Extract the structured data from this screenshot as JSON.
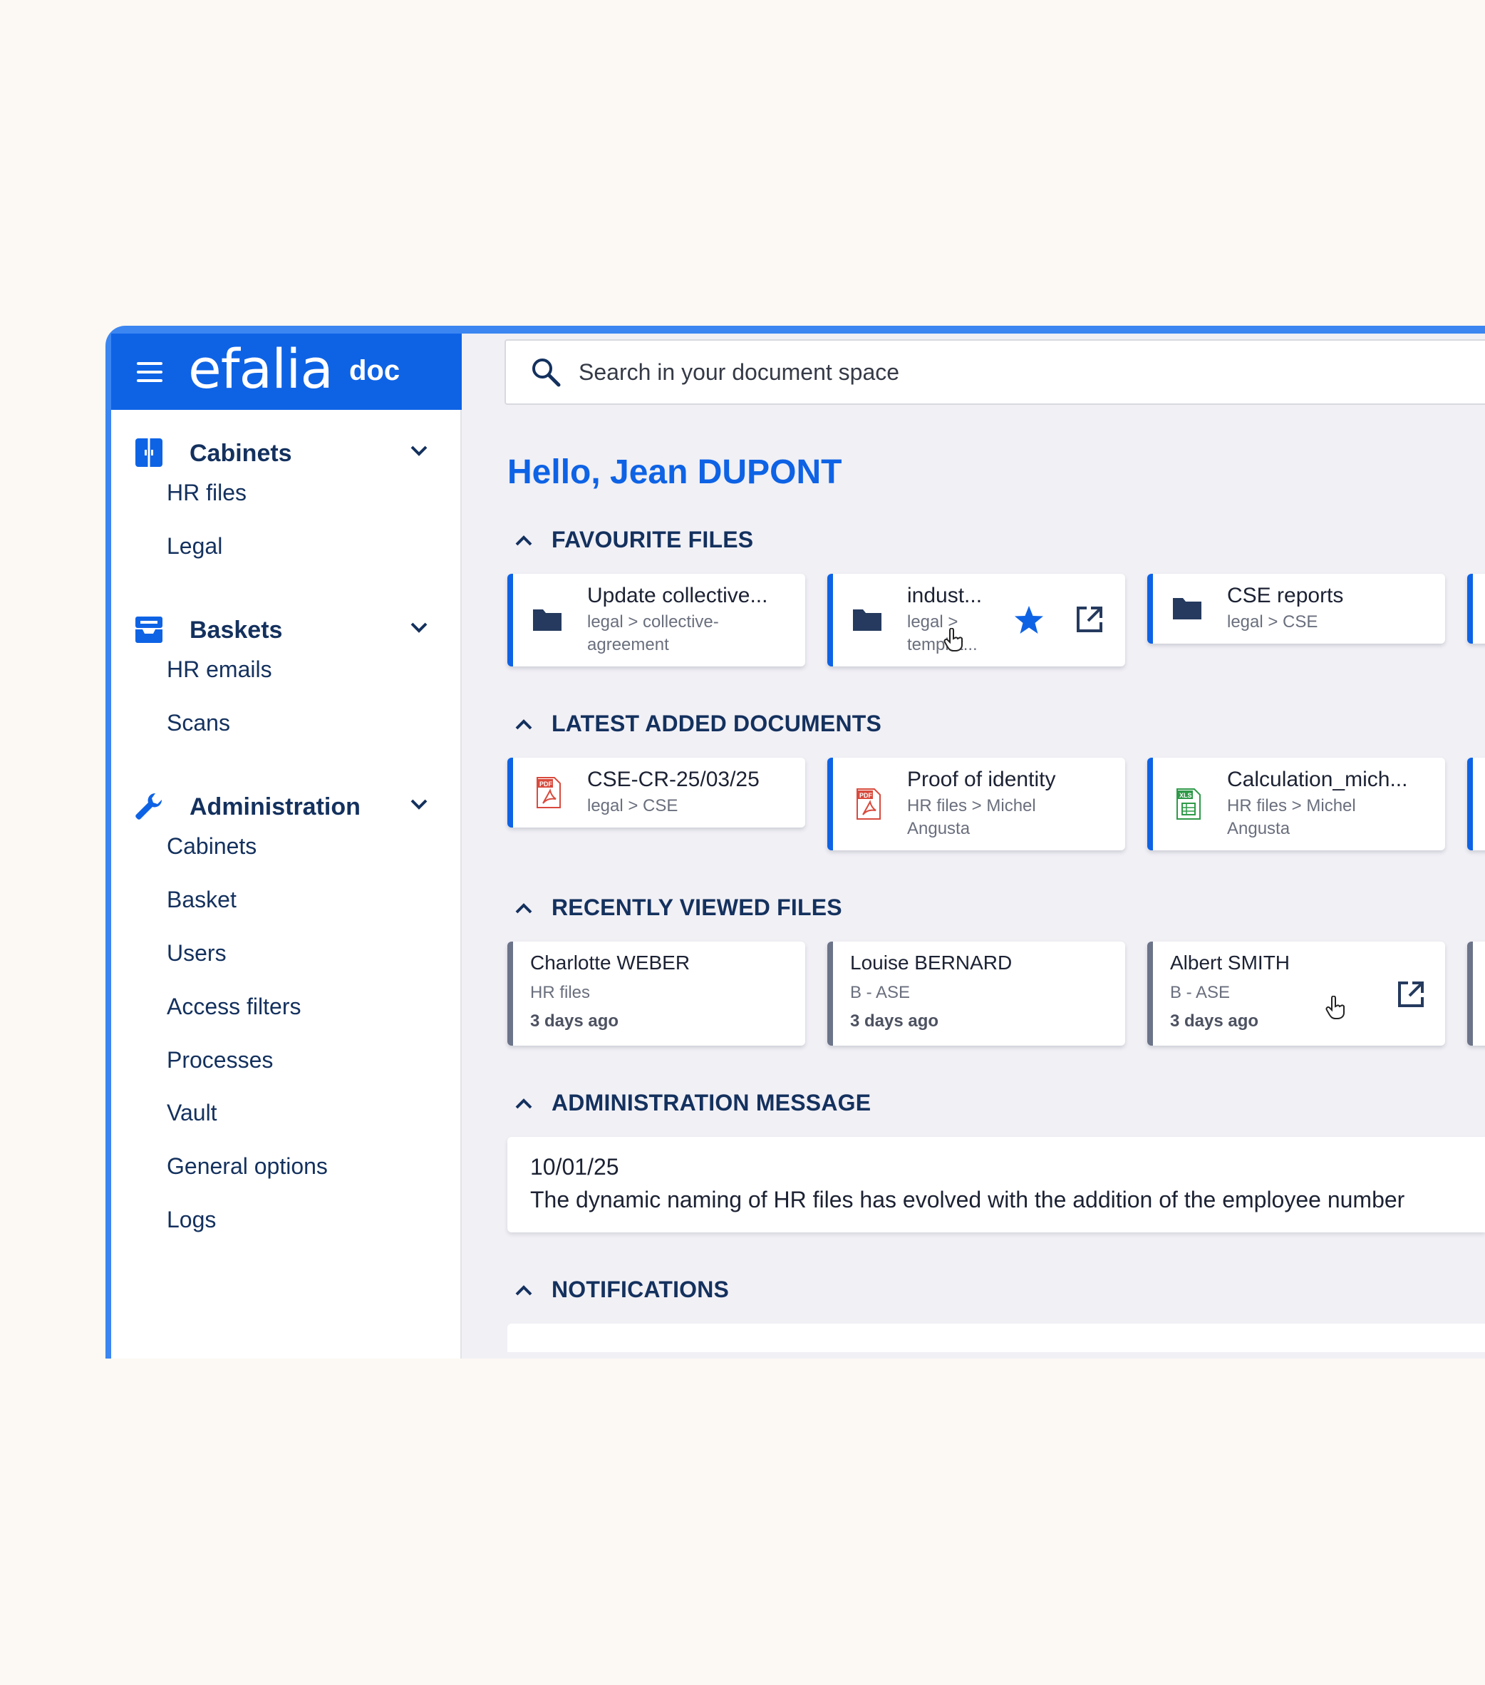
{
  "app": {
    "logo_word": "efalia",
    "logo_suffix": "doc",
    "search_placeholder": "Search in your document space"
  },
  "sidebar": {
    "sections": [
      {
        "title": "Cabinets",
        "icon": "cabinet-icon",
        "items": [
          "HR files",
          "Legal"
        ]
      },
      {
        "title": "Baskets",
        "icon": "inbox-tray-icon",
        "items": [
          "HR emails",
          "Scans"
        ]
      },
      {
        "title": "Administration",
        "icon": "wrench-icon",
        "items": [
          "Cabinets",
          "Basket",
          "Users",
          "Access filters",
          "Processes",
          "Vault",
          "General options",
          "Logs"
        ]
      }
    ]
  },
  "main": {
    "greeting": "Hello, Jean DUPONT",
    "favourites": {
      "title": "FAVOURITE FILES",
      "cards": [
        {
          "title": "Update collective...",
          "path_1": "legal > collective-",
          "path_2": "agreement",
          "icon": "folder-icon"
        },
        {
          "title": "indust...",
          "path_1": "legal >",
          "path_2": "templat...",
          "icon": "folder-icon",
          "starred": true
        },
        {
          "title": "CSE reports",
          "path_1": "legal > CSE",
          "path_2": "",
          "icon": "folder-icon"
        }
      ]
    },
    "latest": {
      "title": "LATEST ADDED DOCUMENTS",
      "cards": [
        {
          "title": "CSE-CR-25/03/25",
          "path_1": "legal > CSE",
          "path_2": "",
          "icon": "pdf-file-icon",
          "badge": "PDF"
        },
        {
          "title": "Proof of identity",
          "path_1": "HR files > Michel",
          "path_2": "Angusta",
          "icon": "pdf-file-icon",
          "badge": "PDF"
        },
        {
          "title": "Calculation_mich...",
          "path_1": "HR files > Michel",
          "path_2": "Angusta",
          "icon": "xls-file-icon",
          "badge": "XLS"
        }
      ]
    },
    "recent": {
      "title": "RECENTLY VIEWED FILES",
      "cards": [
        {
          "name": "Charlotte WEBER",
          "sub": "HR files",
          "when": "3 days ago"
        },
        {
          "name": "Louise BERNARD",
          "sub": "B - ASE",
          "when": "3 days ago"
        },
        {
          "name": "Albert SMITH",
          "sub": "B - ASE",
          "when": "3 days ago"
        }
      ]
    },
    "admin_message": {
      "title": "ADMINISTRATION MESSAGE",
      "date": "10/01/25",
      "body": "The dynamic naming of HR files has evolved with the addition of the employee number"
    },
    "notifications": {
      "title": "NOTIFICATIONS"
    }
  },
  "colors": {
    "brand_blue": "#0e63e5",
    "frame_blue": "#3b86f1",
    "navy_text": "#14315e",
    "page_bg": "#fcf8f3",
    "content_bg": "#f1f0f5",
    "recent_card_accent": "#6b7489"
  }
}
